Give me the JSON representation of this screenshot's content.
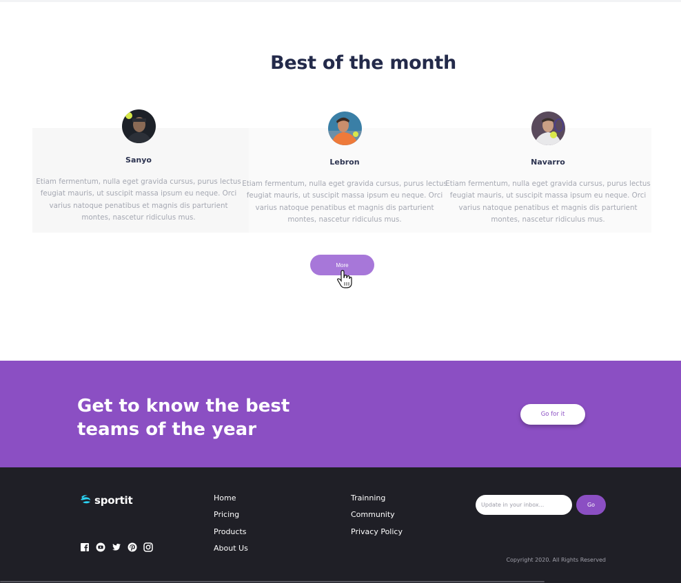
{
  "best": {
    "title": "Best of the month",
    "cards": [
      {
        "name": "Sanyo",
        "text": "Etiam fermentum, nulla eget gravida cursus, purus lectus feugiat mauris, ut suscipit massa ipsum eu neque. Orci varius natoque penatibus et magnis dis parturient montes, nascetur ridiculus mus."
      },
      {
        "name": "Lebron",
        "text": "Etiam fermentum, nulla eget gravida cursus, purus lectus feugiat mauris, ut suscipit massa ipsum eu neque. Orci varius natoque penatibus et magnis dis parturient montes, nascetur ridiculus mus."
      },
      {
        "name": "Navarro",
        "text": "Etiam fermentum, nulla eget gravida cursus, purus lectus feugiat mauris, ut suscipit massa ipsum eu neque. Orci varius natoque penatibus et magnis dis parturient montes, nascetur ridiculus mus."
      }
    ],
    "more_label": "More"
  },
  "banner": {
    "title_line1": "Get to know the best",
    "title_line2": "teams of the year",
    "button_label": "Go for it"
  },
  "footer": {
    "logo": "sportit",
    "nav_col1": [
      "Home",
      "Pricing",
      "Products",
      "About Us"
    ],
    "nav_col2": [
      "Trainning",
      "Community",
      "Privacy Policy"
    ],
    "social_icons": [
      "facebook-icon",
      "youtube-icon",
      "twitter-icon",
      "pinterest-icon",
      "instagram-icon"
    ],
    "subscribe_placeholder": "Update in your inbox...",
    "subscribe_button": "Go",
    "copyright": "Copyright 2020. All Rights Reserved"
  },
  "colors": {
    "accent": "#8b4fc3",
    "accent_light": "#a777d9",
    "heading": "#232a4a",
    "footer_bg": "#1f1f26",
    "logo_icon": "#2bd4f5"
  }
}
